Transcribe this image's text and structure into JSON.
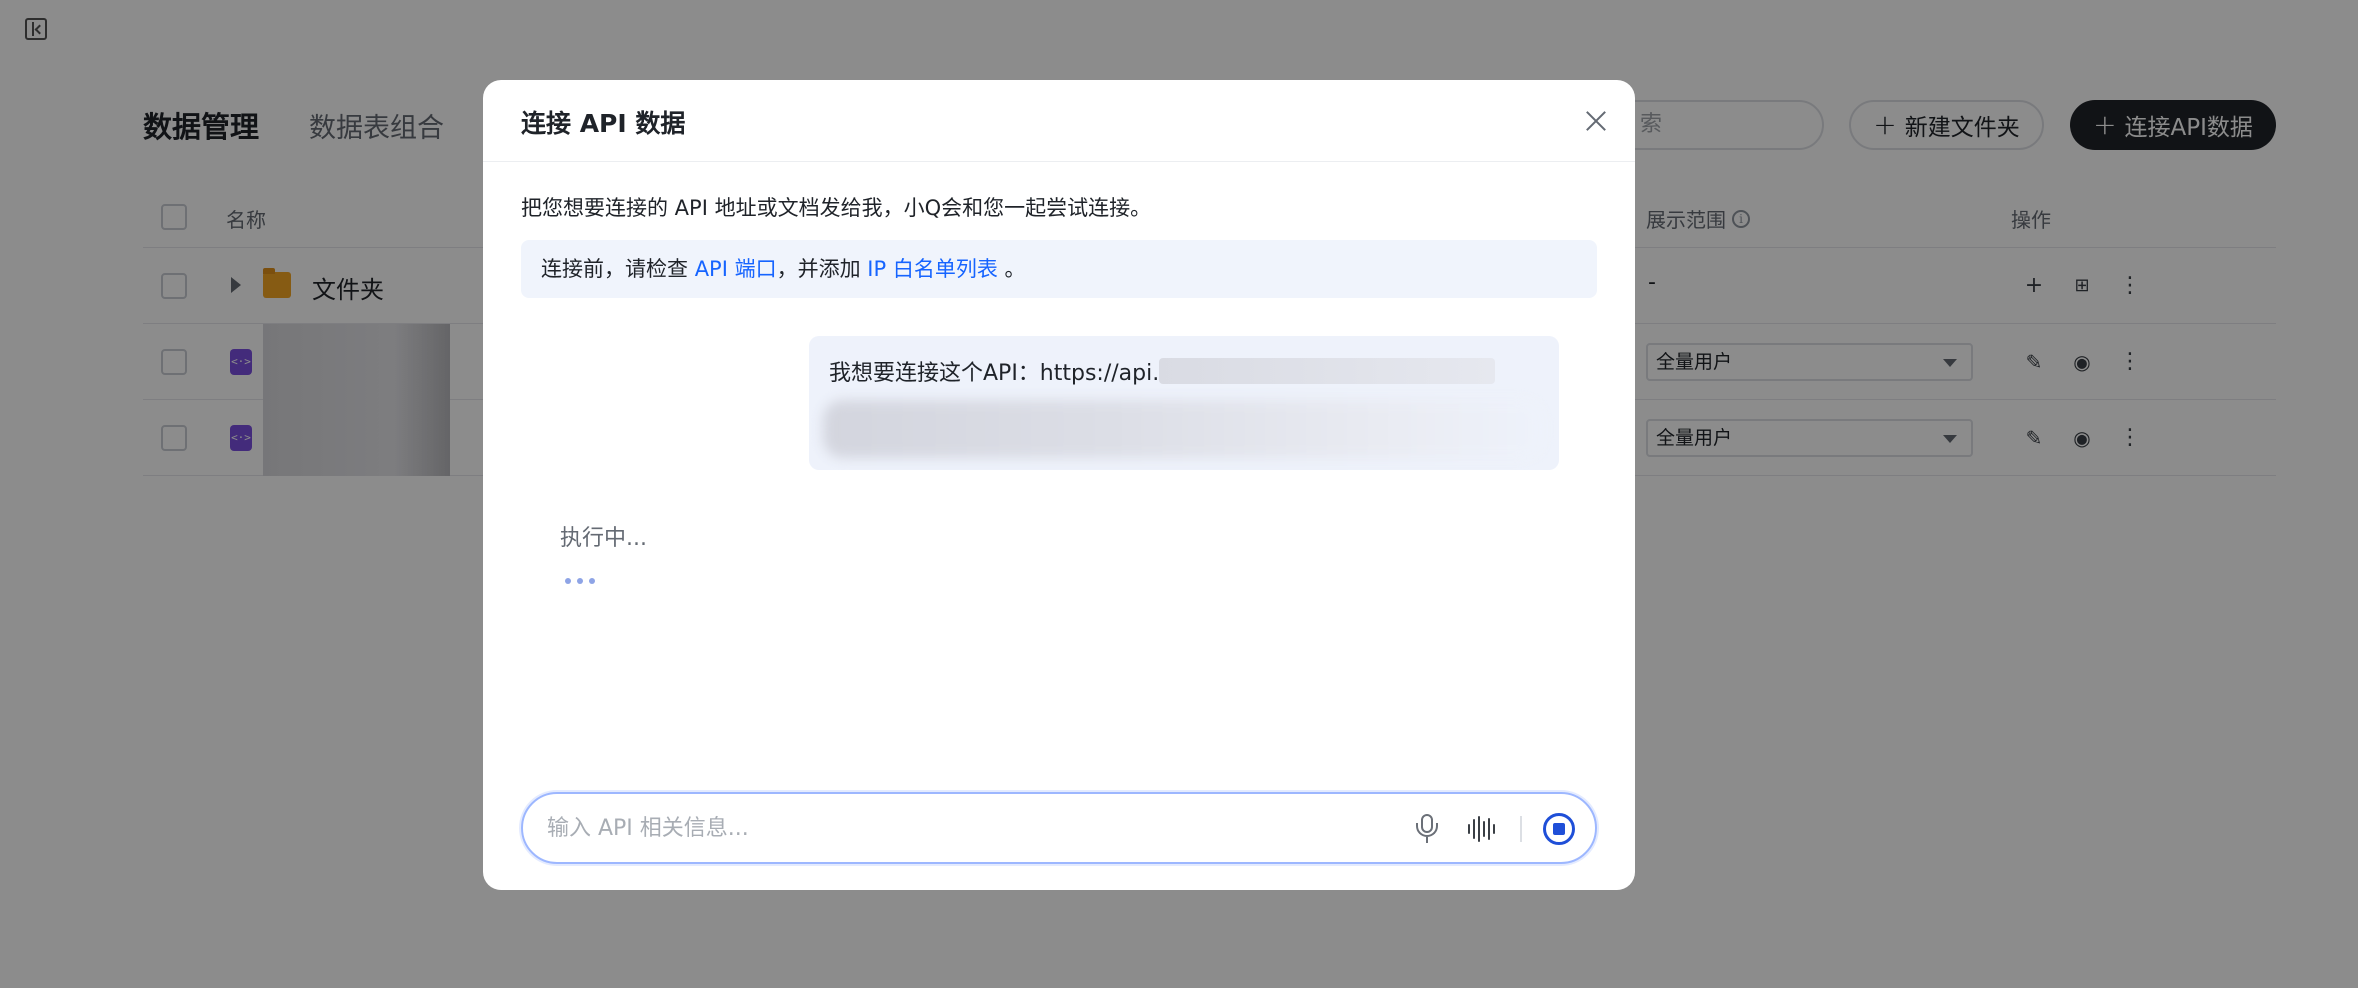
{
  "page": {
    "tabs": [
      "数据管理",
      "数据表组合"
    ],
    "search_placeholder": "索",
    "new_folder_label": "新建文件夹",
    "connect_api_label": "连接API数据",
    "table": {
      "columns": {
        "name": "名称",
        "scope": "展示范围",
        "action": "操作"
      },
      "rows": [
        {
          "type": "folder",
          "name": "文件夹",
          "scope": "-"
        },
        {
          "type": "api",
          "name": "",
          "scope": "全量用户"
        },
        {
          "type": "api",
          "name": "",
          "scope": "全量用户"
        }
      ]
    }
  },
  "modal": {
    "title": "连接 API 数据",
    "description": "把您想要连接的 API 地址或文档发给我，小Q会和您一起尝试连接。",
    "notice": {
      "prefix": "连接前，请检查 ",
      "link1": "API 端口",
      "middle": "，并添加 ",
      "link2": "IP 白名单列表",
      "suffix": " 。"
    },
    "user_message": "我想要连接这个API：https://api.r",
    "status": "执行中...",
    "input_placeholder": "输入 API 相关信息..."
  },
  "icons": {
    "sidebar_toggle": "sidebar-collapse-icon",
    "close": "close-icon",
    "mic": "microphone-icon",
    "voice": "voice-wave-icon",
    "stop": "stop-icon",
    "folder": "folder-icon",
    "api": "api-code-icon"
  },
  "colors": {
    "accent": "#1664ff",
    "api_icon": "#7b4fe0",
    "folder": "#f5a623",
    "primary_button": "#1f2329"
  }
}
